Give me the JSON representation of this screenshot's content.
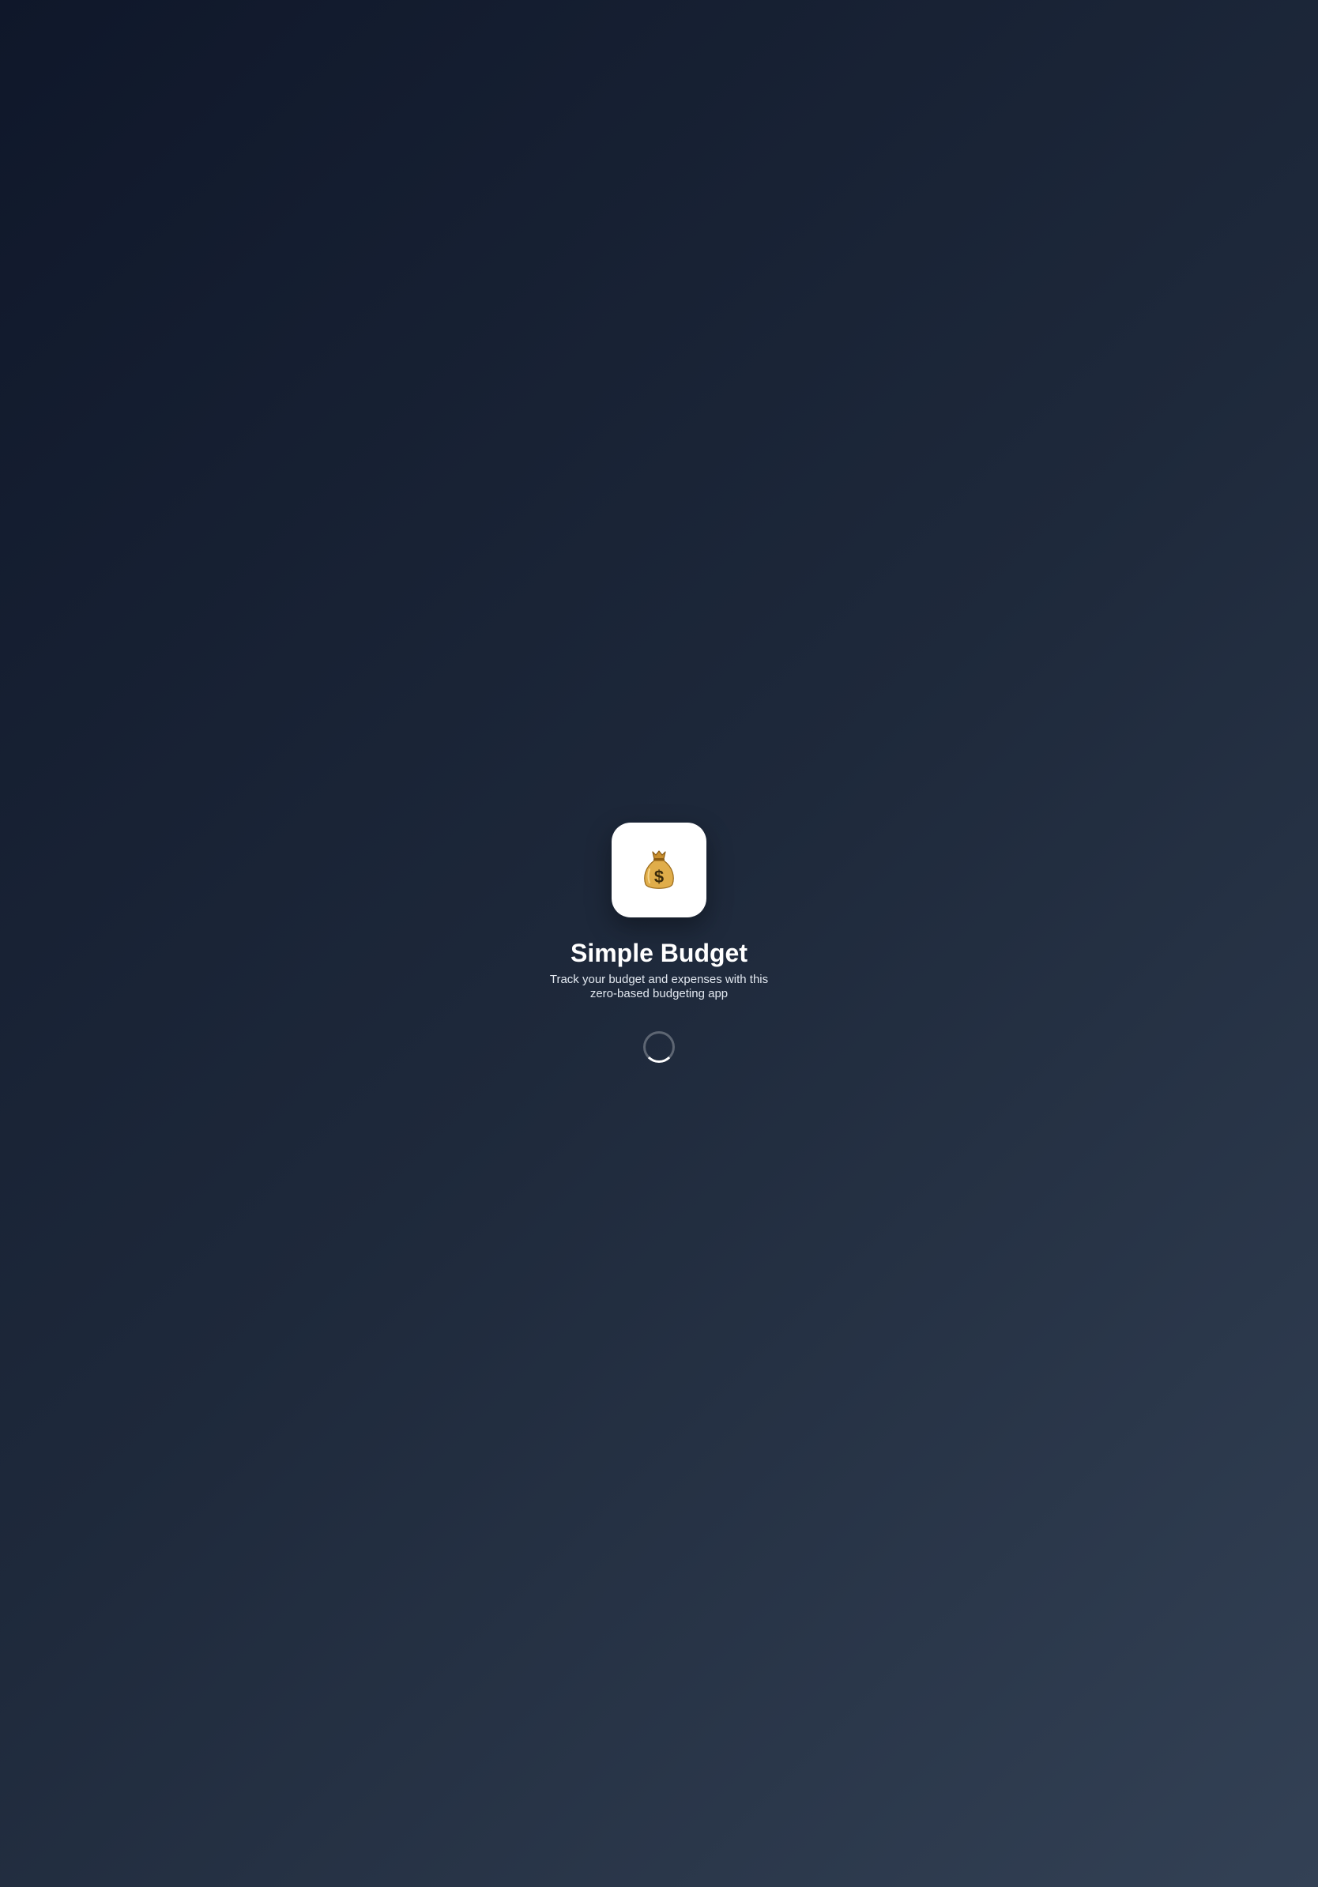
{
  "app": {
    "icon": "money-bag-icon",
    "title": "Simple Budget",
    "subtitle": "Track your budget and expenses with this zero-based budgeting app"
  },
  "loading": {
    "indicator": "spinner-icon"
  },
  "colors": {
    "background_start": "#0f172a",
    "background_end": "#334155",
    "icon_tile": "#ffffff",
    "title_text": "#ffffff",
    "subtitle_text": "#e2e8f0",
    "money_bag": "#d9a441"
  }
}
